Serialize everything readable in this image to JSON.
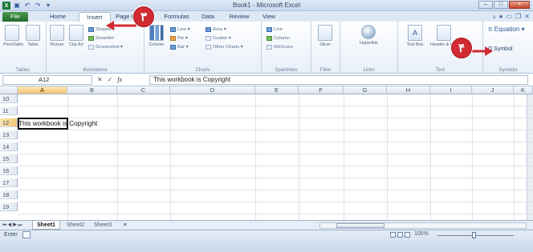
{
  "title_bar": {
    "title": "Book1 - Microsoft Excel",
    "window_buttons": [
      "–",
      "□",
      "×"
    ]
  },
  "quick_access": [
    "excel-logo",
    "save-icon",
    "undo-icon",
    "redo-icon",
    "customize-icon"
  ],
  "ribbon_tabs": [
    {
      "label": "File"
    },
    {
      "label": "Home"
    },
    {
      "label": "Insert"
    },
    {
      "label": "Page Layout"
    },
    {
      "label": "Formulas"
    },
    {
      "label": "Data"
    },
    {
      "label": "Review"
    },
    {
      "label": "View"
    }
  ],
  "tab_right_icons": [
    "minimize-ribbon-icon",
    "help-icon",
    "window-minimize-icon",
    "window-restore-icon",
    "window-close-icon"
  ],
  "ribbon": {
    "groups": {
      "tables": {
        "label": "Tables",
        "pivot": "PivotTable",
        "table": "Table"
      },
      "illustrations": {
        "label": "Illustrations",
        "picture": "Picture",
        "clip": "Clip Art",
        "shapes": "Shapes ▾",
        "smartart": "SmartArt",
        "screenshot": "Screenshot ▾"
      },
      "charts": {
        "label": "Charts",
        "column": "Column",
        "line": "Line ▾",
        "pie": "Pie ▾",
        "bar": "Bar ▾",
        "area": "Area ▾",
        "scatter": "Scatter ▾",
        "other": "Other Charts ▾"
      },
      "sparklines": {
        "label": "Sparklines",
        "line": "Line",
        "column": "Column",
        "winloss": "Win/Loss"
      },
      "filter": {
        "label": "Filter",
        "slicer": "Slicer"
      },
      "links": {
        "label": "Links",
        "hyperlink": "Hyperlink"
      },
      "text": {
        "label": "Text",
        "textbox": "Text Box",
        "header_footer": "Header & Footer"
      },
      "symbols": {
        "label": "Symbols",
        "equation": "π Equation ▾",
        "symbol": "Ω Symbol"
      }
    }
  },
  "callouts": {
    "step3": "٣",
    "step4": "۴"
  },
  "formula_bar": {
    "name_box": "A12",
    "cancel": "✕",
    "enter": "✓",
    "fx": "fx",
    "content": "This workbook is Copyright"
  },
  "columns": [
    "A",
    "B",
    "C",
    "D",
    "E",
    "F",
    "G",
    "H",
    "I",
    "J",
    "K"
  ],
  "rows": [
    "10",
    "11",
    "12",
    "13",
    "14",
    "15",
    "16",
    "17",
    "18",
    "19"
  ],
  "cells": {
    "A12": "This workbook is Copyright"
  },
  "sheets": [
    "Sheet1",
    "Sheet2",
    "Sheet3"
  ],
  "status": {
    "mode": "Enter",
    "zoom": "100%"
  },
  "colors": {
    "file_tab": "#1f6b2c",
    "callout": "#d22a33",
    "active_header": "#f3c675",
    "ribbon_bg": "#e8eff8"
  }
}
